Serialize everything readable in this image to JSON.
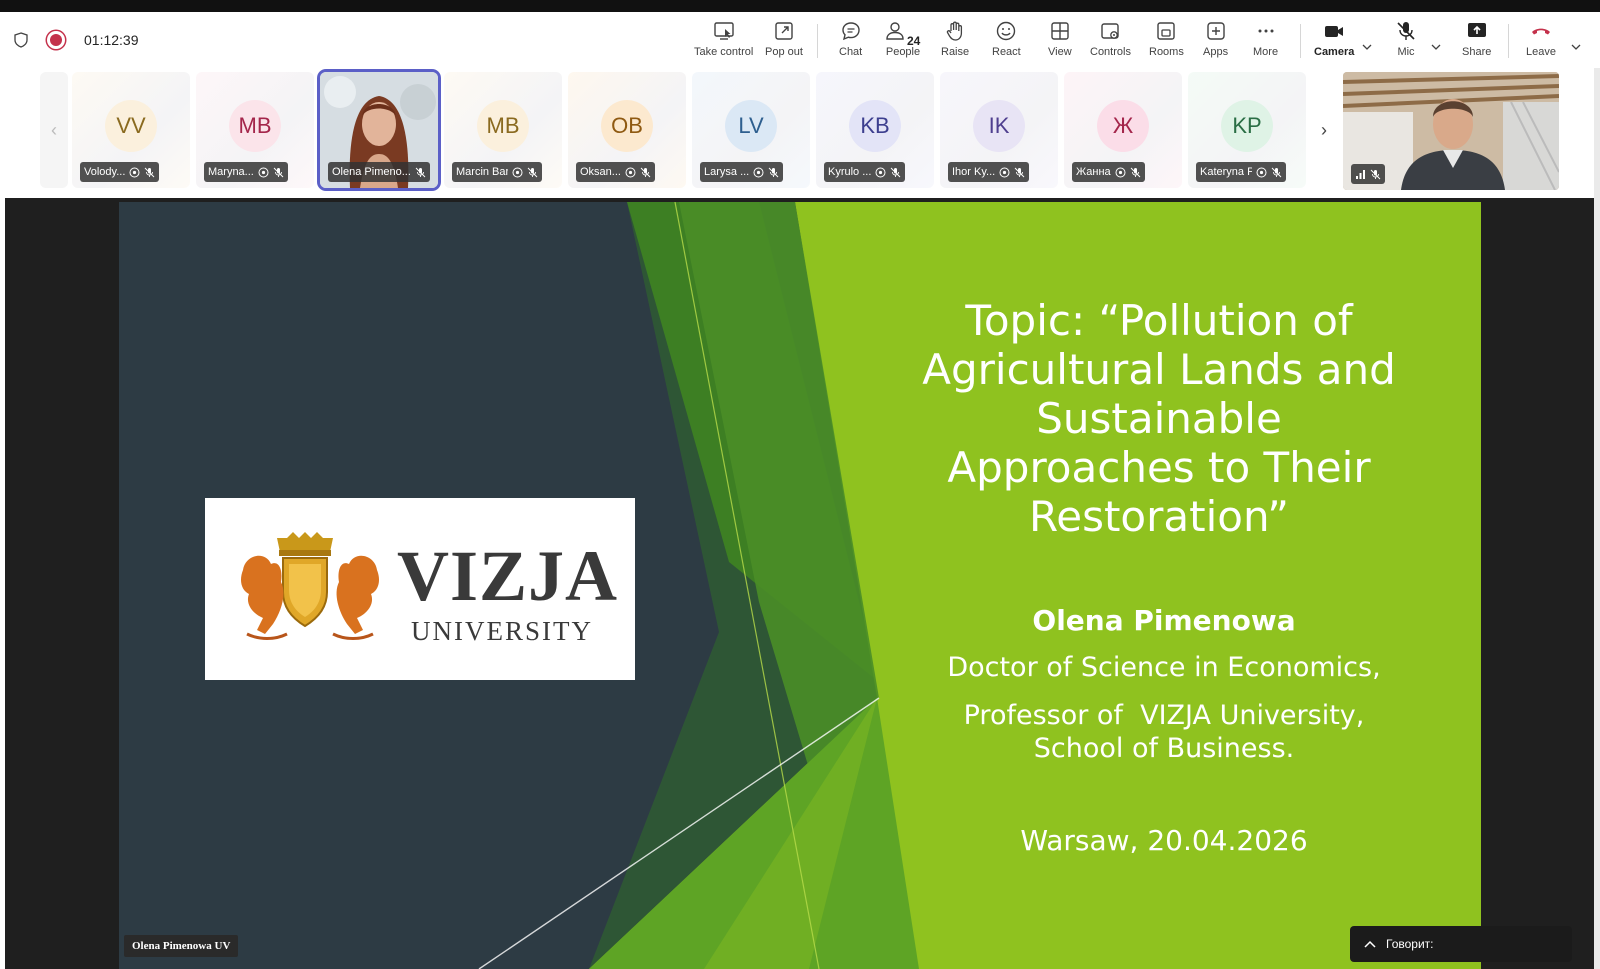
{
  "meeting": {
    "timer": "01:12:39",
    "recording": true
  },
  "toolbar": {
    "take_control": "Take control",
    "pop_out": "Pop out",
    "chat": "Chat",
    "people": "People",
    "people_count": "24",
    "raise": "Raise",
    "react": "React",
    "view": "View",
    "controls": "Controls",
    "rooms": "Rooms",
    "apps": "Apps",
    "more": "More",
    "camera": "Camera",
    "mic": "Mic",
    "share": "Share",
    "leave": "Leave"
  },
  "participants": [
    {
      "initials": "VV",
      "name": "Volody...",
      "bg": "#fbf0dd",
      "fg": "#8a6a1f"
    },
    {
      "initials": "MB",
      "name": "Maryna...",
      "bg": "#fbe4ea",
      "fg": "#a4264b"
    },
    {
      "initials": "",
      "name": "Olena Pimeno...",
      "bg": "#cfd6dc",
      "fg": "#333"
    },
    {
      "initials": "MB",
      "name": "Marcin Bar...",
      "bg": "#fbf0dd",
      "fg": "#8a6a1f"
    },
    {
      "initials": "OB",
      "name": "Oksan...",
      "bg": "#fce9cf",
      "fg": "#8f5a12"
    },
    {
      "initials": "LV",
      "name": "Larysa ...",
      "bg": "#dbe8f5",
      "fg": "#2e5f8f"
    },
    {
      "initials": "KB",
      "name": "Kyrulo ...",
      "bg": "#e3e4f7",
      "fg": "#3d3f8f"
    },
    {
      "initials": "IK",
      "name": "Ihor Ky...",
      "bg": "#e8e4f5",
      "fg": "#4f3f8f"
    },
    {
      "initials": "Ж",
      "name": "Жанна",
      "bg": "#fbdde8",
      "fg": "#a4264b"
    },
    {
      "initials": "KP",
      "name": "Kateryna P...",
      "bg": "#dff3e6",
      "fg": "#2a6e45"
    }
  ],
  "slide": {
    "logo_main": "VIZJA",
    "logo_sub": "UNIVERSITY",
    "title": "Topic: “Pollution of Agricultural Lands and Sustainable Approaches to Their Restoration”",
    "author": "Olena Pimenowa",
    "degree": "Doctor of Science in Economics,",
    "position_line1": "Professor of  VIZJA University,",
    "position_line2": "School of Business.",
    "place_date": "Warsaw, 20.04.2026"
  },
  "presenter_label": "Olena Pimenowa UV",
  "speaking_label": "Говорит:"
}
